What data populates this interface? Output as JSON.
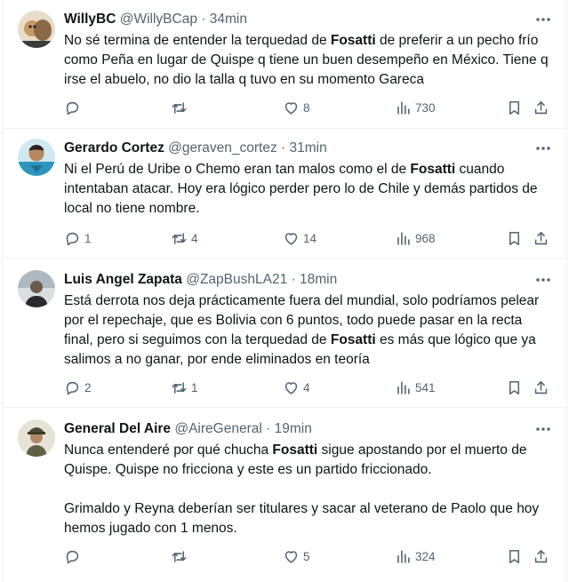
{
  "tweets": [
    {
      "name": "WillyBC",
      "handle": "@WillyBCap",
      "sep": " · ",
      "time": "34min",
      "text": [
        {
          "t": "No sé termina de entender la terquedad de "
        },
        {
          "b": "Fosatti"
        },
        {
          "t": " de preferir a un pecho frío como Peña en lugar de Quispe q tiene un buen desempeño en México. Tiene q irse el abuelo, no dio la talla q tuvo en su momento Gareca"
        }
      ],
      "replies": "",
      "retweets": "",
      "likes": "8",
      "views": "730",
      "avatar_color": "#c79a64"
    },
    {
      "name": "Gerardo Cortez",
      "handle": "@geraven_cortez",
      "sep": " · ",
      "time": "31min",
      "text": [
        {
          "t": "Ni el Perú de Uribe o Chemo eran tan malos como el de "
        },
        {
          "b": "Fosatti"
        },
        {
          "t": " cuando intentaban atacar. Hoy era lógico perder pero lo de Chile y demás partidos de local no tiene nombre."
        }
      ],
      "replies": "1",
      "retweets": "4",
      "likes": "14",
      "views": "968",
      "avatar_color": "#3fa3c9"
    },
    {
      "name": "Luis Angel Zapata",
      "handle": "@ZapBushLA21",
      "sep": " · ",
      "time": "18min",
      "text": [
        {
          "t": "Está derrota nos deja prácticamente fuera del mundial, solo podríamos pelear por el repechaje, que es Bolivia con 6 puntos, todo puede pasar en la recta final, pero si seguimos con la terquedad de "
        },
        {
          "b": "Fosatti"
        },
        {
          "t": " es más que lógico que ya salimos a no ganar, por ende eliminados en teoría"
        }
      ],
      "replies": "2",
      "retweets": "1",
      "likes": "4",
      "views": "541",
      "avatar_color": "#8f9aa3"
    },
    {
      "name": "General Del Aire",
      "handle": "@AireGeneral",
      "sep": " · ",
      "time": "19min",
      "text": [
        {
          "t": "Nunca entenderé por qué chucha "
        },
        {
          "b": "Fosatti"
        },
        {
          "t": " sigue apostando por el muerto de Quispe. Quispe no fricciona y este es un partido friccionado."
        },
        {
          "br": true
        },
        {
          "br": true
        },
        {
          "t": "Grimaldo y Reyna deberían ser titulares y sacar al veterano de Paolo que hoy hemos jugado con 1 menos."
        }
      ],
      "replies": "",
      "retweets": "",
      "likes": "5",
      "views": "324",
      "avatar_color": "#6b6a4e"
    }
  ],
  "icons": {
    "reply": "speech-bubble",
    "retweet": "repost-arrows",
    "like": "heart-outline",
    "views": "bar-chart",
    "bookmark": "bookmark-outline",
    "share": "share-arrow-up",
    "more": "horizontal-dots"
  },
  "colors": {
    "text": "#0f1419",
    "secondary": "#536471",
    "divider": "#eff3f4"
  }
}
